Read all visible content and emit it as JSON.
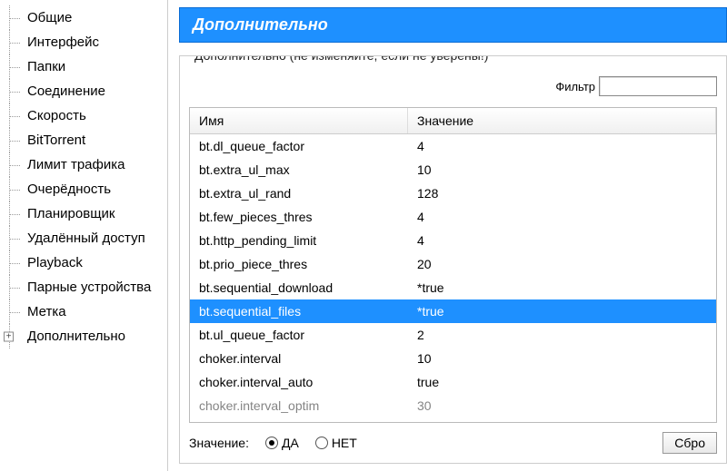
{
  "sidebar": {
    "items": [
      {
        "label": "Общие"
      },
      {
        "label": "Интерфейс"
      },
      {
        "label": "Папки"
      },
      {
        "label": "Соединение"
      },
      {
        "label": "Скорость"
      },
      {
        "label": "BitTorrent"
      },
      {
        "label": "Лимит трафика"
      },
      {
        "label": "Очерёдность"
      },
      {
        "label": "Планировщик"
      },
      {
        "label": "Удалённый доступ"
      },
      {
        "label": "Playback"
      },
      {
        "label": "Парные устройства"
      },
      {
        "label": "Метка"
      },
      {
        "label": "Дополнительно",
        "expandable": true
      }
    ]
  },
  "header": {
    "title": "Дополнительно"
  },
  "group": {
    "caption": "Дополнительно (не изменяйте, если не уверены!)",
    "filter_label": "Фильтр"
  },
  "columns": {
    "name": "Имя",
    "value": "Значение"
  },
  "rows": [
    {
      "name": "bt.dl_queue_factor",
      "value": "4"
    },
    {
      "name": "bt.extra_ul_max",
      "value": "10"
    },
    {
      "name": "bt.extra_ul_rand",
      "value": "128"
    },
    {
      "name": "bt.few_pieces_thres",
      "value": "4"
    },
    {
      "name": "bt.http_pending_limit",
      "value": "4"
    },
    {
      "name": "bt.prio_piece_thres",
      "value": "20"
    },
    {
      "name": "bt.sequential_download",
      "value": "*true"
    },
    {
      "name": "bt.sequential_files",
      "value": "*true",
      "selected": true
    },
    {
      "name": "bt.ul_queue_factor",
      "value": "2"
    },
    {
      "name": "choker.interval",
      "value": "10"
    },
    {
      "name": "choker.interval_auto",
      "value": "true"
    },
    {
      "name": "choker.interval_optim",
      "value": "30",
      "cut": true
    }
  ],
  "value_editor": {
    "label": "Значение:",
    "radio_yes": "ДА",
    "radio_no": "НЕТ",
    "reset_button": "Сбро"
  }
}
